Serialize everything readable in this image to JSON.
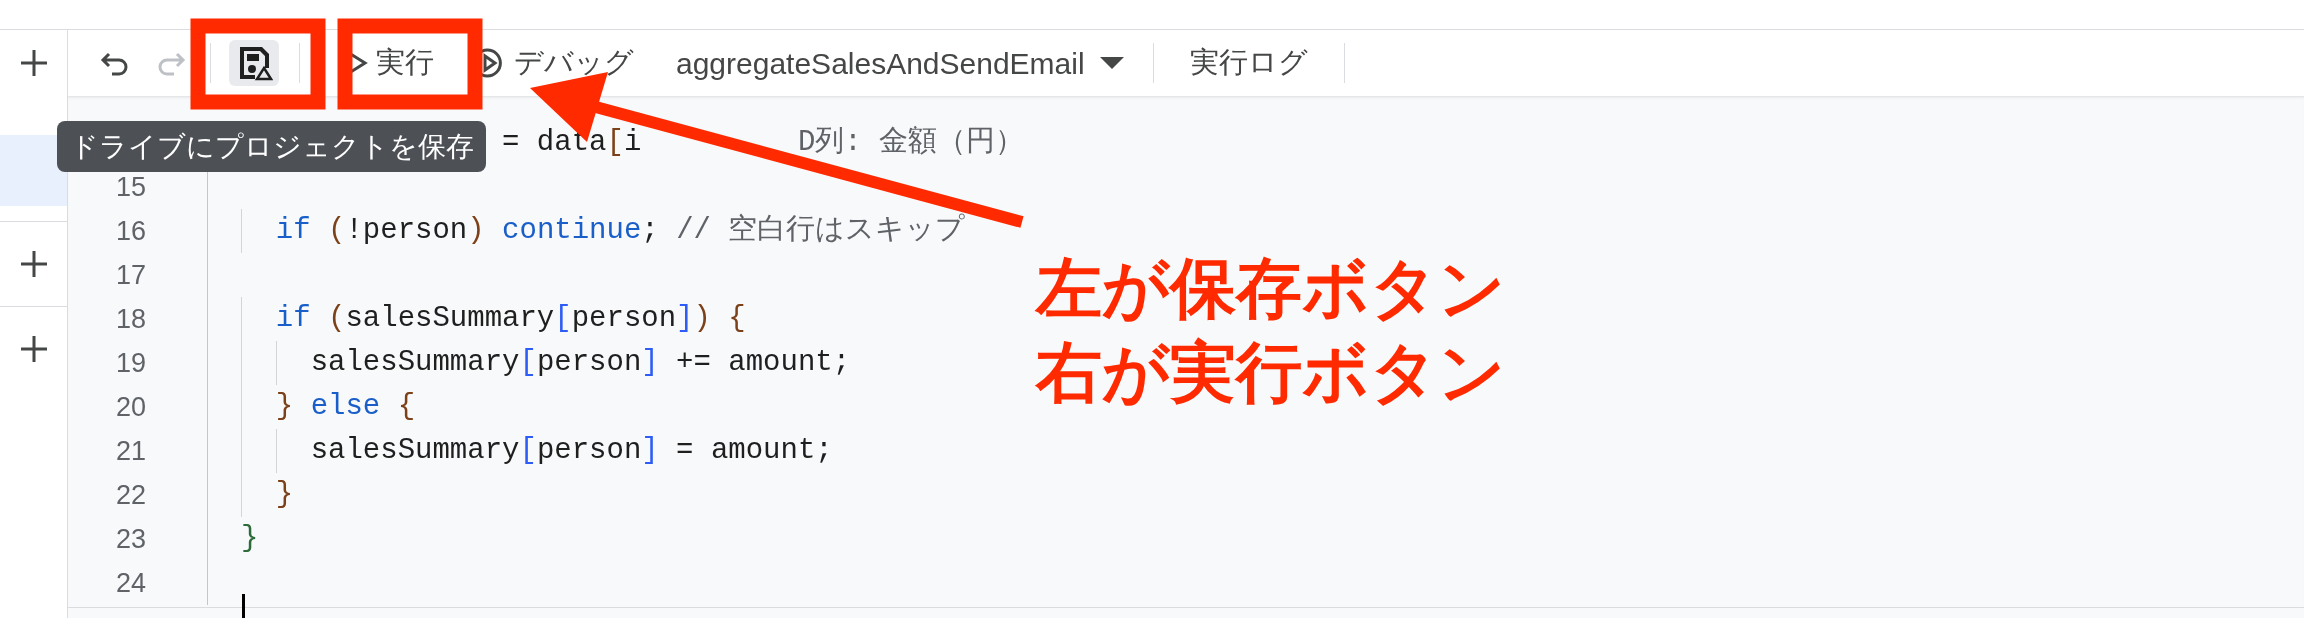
{
  "rail": {
    "items": [
      {
        "kind": "add",
        "selected": false
      },
      {
        "kind": "panel",
        "selected": true
      },
      {
        "kind": "add",
        "selected": false
      },
      {
        "kind": "add",
        "selected": false
      }
    ]
  },
  "toolbar": {
    "undo": {
      "disabled": false
    },
    "redo": {
      "disabled": true
    },
    "save": {
      "hovered": true
    },
    "run": {
      "label": "実行"
    },
    "debug": {
      "label": "デバッグ"
    },
    "function_select": {
      "value": "aggregateSalesAndSendEmail"
    },
    "log": {
      "label": "実行ログ"
    }
  },
  "tooltip": {
    "text": "ドライブにプロジェクトを保存"
  },
  "code_lines": [
    {
      "tokens": [
        {
          "kind": "plain",
          "text": "               = data"
        },
        {
          "kind": "paren",
          "text": "["
        },
        {
          "kind": "plain",
          "text": "i"
        },
        {
          "kind": "comment",
          "text": "         D列: 金額（円）"
        }
      ]
    },
    {
      "number": "15"
    },
    {
      "number": "16",
      "tokens": [
        {
          "kind": "keyword",
          "text": "  if "
        },
        {
          "kind": "paren",
          "text": "("
        },
        {
          "kind": "plain",
          "text": "!person"
        },
        {
          "kind": "paren",
          "text": ")"
        },
        {
          "kind": "keyword",
          "text": " continue"
        },
        {
          "kind": "plain",
          "text": "; "
        },
        {
          "kind": "comment",
          "text": "// 空白行はスキップ"
        }
      ]
    },
    {
      "number": "17"
    },
    {
      "number": "18",
      "tokens": [
        {
          "kind": "keyword",
          "text": "  if "
        },
        {
          "kind": "paren",
          "text": "("
        },
        {
          "kind": "plain",
          "text": "salesSummary"
        },
        {
          "kind": "bracket",
          "text": "["
        },
        {
          "kind": "plain",
          "text": "person"
        },
        {
          "kind": "bracket",
          "text": "]"
        },
        {
          "kind": "paren",
          "text": ") {"
        }
      ]
    },
    {
      "number": "19",
      "tokens": [
        {
          "kind": "plain",
          "text": "    salesSummary"
        },
        {
          "kind": "bracket",
          "text": "["
        },
        {
          "kind": "plain",
          "text": "person"
        },
        {
          "kind": "bracket",
          "text": "]"
        },
        {
          "kind": "plain",
          "text": " += amount;"
        }
      ]
    },
    {
      "number": "20",
      "tokens": [
        {
          "kind": "paren",
          "text": "  } "
        },
        {
          "kind": "keyword",
          "text": "else "
        },
        {
          "kind": "paren",
          "text": "{"
        }
      ]
    },
    {
      "number": "21",
      "tokens": [
        {
          "kind": "plain",
          "text": "    salesSummary"
        },
        {
          "kind": "bracket",
          "text": "["
        },
        {
          "kind": "plain",
          "text": "person"
        },
        {
          "kind": "bracket",
          "text": "]"
        },
        {
          "kind": "plain",
          "text": " = amount;"
        }
      ]
    },
    {
      "number": "22",
      "tokens": [
        {
          "kind": "paren",
          "text": "  }"
        }
      ]
    },
    {
      "number": "23",
      "tokens": [
        {
          "kind": "brace",
          "text": "}"
        }
      ]
    },
    {
      "number": "24"
    }
  ],
  "annotation": {
    "lines": [
      "左が保存ボタン",
      "右が実行ボタン"
    ]
  }
}
